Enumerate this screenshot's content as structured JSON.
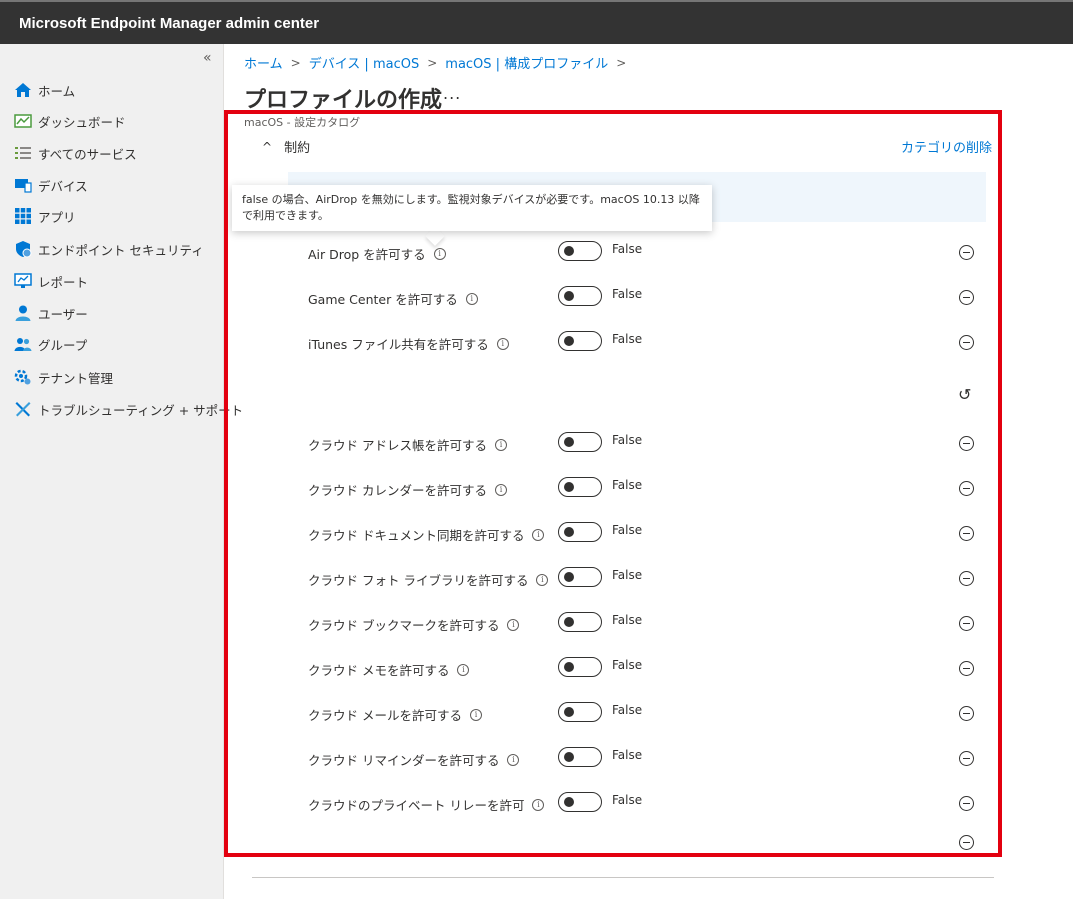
{
  "app": {
    "title": "Microsoft Endpoint Manager admin center"
  },
  "sidebar": {
    "collapse_glyph": "«",
    "items": [
      {
        "label": "ホーム",
        "icon": "home-icon"
      },
      {
        "label": "ダッシュボード",
        "icon": "dashboard-icon"
      },
      {
        "label": "すべてのサービス",
        "icon": "list-icon"
      },
      {
        "label": "デバイス",
        "icon": "devices-icon"
      },
      {
        "label": "アプリ",
        "icon": "apps-grid-icon"
      },
      {
        "label": "エンドポイント セキュリティ",
        "icon": "shield-icon"
      },
      {
        "label": "レポート",
        "icon": "reports-icon"
      },
      {
        "label": "ユーザー",
        "icon": "user-icon"
      },
      {
        "label": "グループ",
        "icon": "group-icon"
      },
      {
        "label": "テナント管理",
        "icon": "tenant-admin-icon"
      },
      {
        "label": "トラブルシューティング + サポート",
        "icon": "troubleshoot-icon"
      }
    ]
  },
  "breadcrumb": {
    "items": [
      "ホーム",
      "デバイス | macOS",
      "macOS | 構成プロファイル"
    ],
    "separator": ">"
  },
  "page": {
    "title": "プロファイルの作成",
    "more": "...",
    "subtitle": "macOS - 設定カタログ",
    "section": {
      "label": "制約",
      "chevron": "^"
    },
    "delete_category": "カテゴリの削除"
  },
  "tooltip": {
    "text": "false の場合、AirDrop を無効にします。監視対象デバイスが必要です。macOS 10.13 以降で利用できます。"
  },
  "info_glyph": "i",
  "undo_glyph": "↺",
  "settings": [
    {
      "label": "Air Drop を許可する",
      "value": "False"
    },
    {
      "label": "Game Center を許可する",
      "value": "False"
    },
    {
      "label": "iTunes ファイル共有を許可する",
      "value": "False"
    },
    {
      "label": "クラウド アドレス帳を許可する",
      "value": "False"
    },
    {
      "label": "クラウド カレンダーを許可する",
      "value": "False"
    },
    {
      "label": "クラウド ドキュメント同期を許可する",
      "value": "False"
    },
    {
      "label": "クラウド フォト ライブラリを許可する",
      "value": "False"
    },
    {
      "label": "クラウド ブックマークを許可する",
      "value": "False"
    },
    {
      "label": "クラウド メモを許可する",
      "value": "False"
    },
    {
      "label": "クラウド メールを許可する",
      "value": "False"
    },
    {
      "label": "クラウド リマインダーを許可する",
      "value": "False"
    },
    {
      "label": "クラウドのプライベート リレーを許可",
      "value": "False"
    }
  ],
  "colors": {
    "accent": "#0078d4",
    "highlight": "#e3000f",
    "topbar": "#333333",
    "sidebar": "#f0f0f0"
  }
}
